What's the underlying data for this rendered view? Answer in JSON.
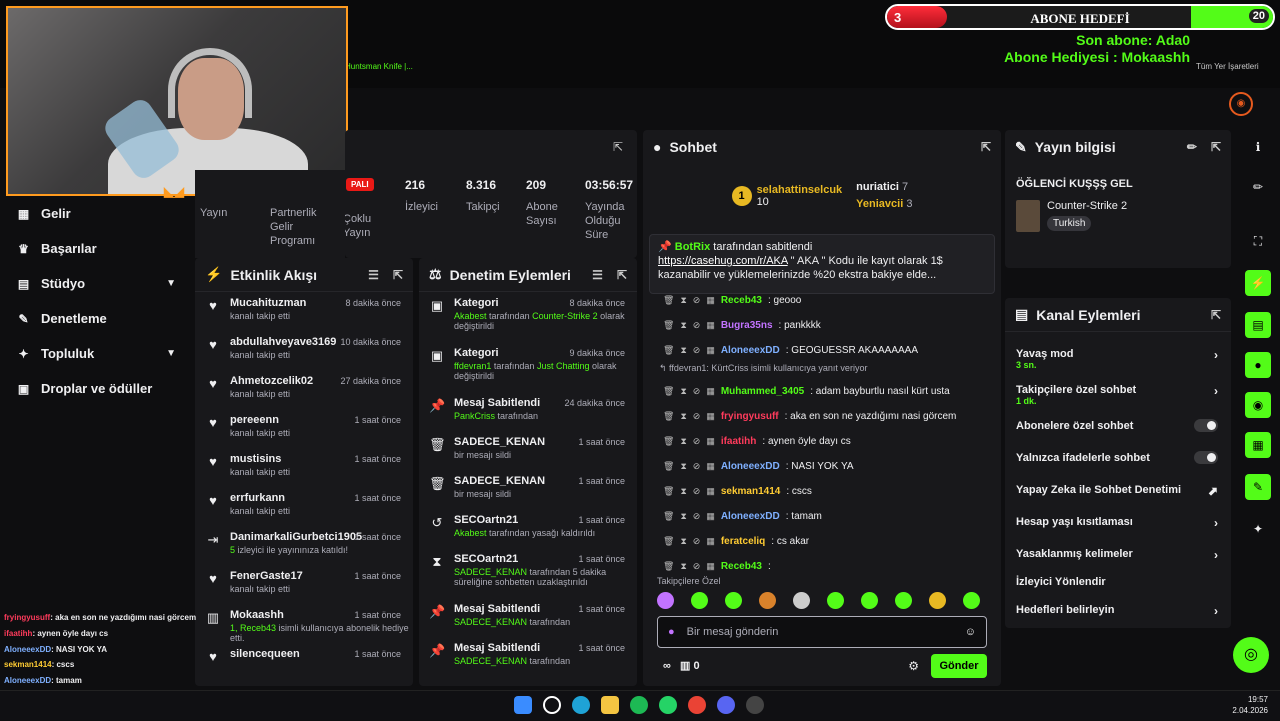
{
  "overlay_goal": {
    "current": "3",
    "title": "ABONE HEDEFİ",
    "target": "20",
    "last_sub_label": "Son abone: Ada0",
    "last_sub_name_partial": "Son abone: Ada0",
    "sub_line": "Son abone: Ada0",
    "gift_line": "Abone Hediyesi : Mokaashh"
  },
  "bookmarks": [
    "Huntsman Knife |..."
  ],
  "bookmarks_right": "Tüm Yer İşaretleri",
  "nav": {
    "items": [
      {
        "label": "Gelir",
        "icon": "income-icon"
      },
      {
        "label": "Başarılar",
        "icon": "trophy-icon"
      },
      {
        "label": "Stüdyo",
        "icon": "studio-icon"
      },
      {
        "label": "Denetleme",
        "icon": "wrench-icon"
      },
      {
        "label": "Topluluk",
        "icon": "community-icon"
      },
      {
        "label": "Droplar ve ödüller",
        "icon": "drops-icon"
      }
    ]
  },
  "stats": {
    "badge": "PALI",
    "tabs": [
      "Yayın",
      "Partnerlik Gelir Programı",
      "Çoklu Yayın"
    ],
    "items": [
      {
        "value": "216",
        "label": "İzleyici"
      },
      {
        "value": "8.316",
        "label": "Takipçi"
      },
      {
        "value": "209",
        "label": "Abone Sayısı"
      },
      {
        "value": "03:56:57",
        "label": "Yayında Olduğu Süre"
      }
    ]
  },
  "activity": {
    "title": "Etkinlik Akışı",
    "items": [
      {
        "name": "Mucahituzman",
        "sub": "kanalı takip etti",
        "time": "8 dakika önce"
      },
      {
        "name": "abdullahveyave3169",
        "sub": "kanalı takip etti",
        "time": "10 dakika önce"
      },
      {
        "name": "Ahmetozcelik02",
        "sub": "kanalı takip etti",
        "time": "27 dakika önce"
      },
      {
        "name": "pereeenn",
        "sub": "kanalı takip etti",
        "time": "1 saat önce"
      },
      {
        "name": "mustisins",
        "sub": "kanalı takip etti",
        "time": "1 saat önce"
      },
      {
        "name": "errfurkann",
        "sub": "kanalı takip etti",
        "time": "1 saat önce"
      },
      {
        "name": "DanimarkaliGurbetci1905",
        "sub_count": "5",
        "sub": "izleyici ile yayınınıza katıldı!",
        "time": "1 saat önce"
      },
      {
        "name": "FenerGaste17",
        "sub": "kanalı takip etti",
        "time": "1 saat önce"
      },
      {
        "name": "Mokaashh",
        "sub_count": "1, Receb43",
        "sub": "isimli kullanıcıya abonelik hediye etti.",
        "time": "1 saat önce"
      },
      {
        "name": "silencequeen",
        "sub": "",
        "time": "1 saat önce"
      }
    ]
  },
  "mod": {
    "title": "Denetim Eylemleri",
    "items": [
      {
        "name": "Kategori",
        "sub_user": "Akabest",
        "sub": "tarafından",
        "sub_target": "Counter-Strike 2",
        "sub2": "olarak değiştirildi",
        "time": "8 dakika önce"
      },
      {
        "name": "Kategori",
        "sub_user": "ffdevran1",
        "sub": "tarafından",
        "sub_target": "Just Chatting",
        "sub2": "olarak değiştirildi",
        "time": "9 dakika önce"
      },
      {
        "name": "Mesaj Sabitlendi",
        "sub_user": "PankCriss",
        "sub": "tarafından",
        "time": "24 dakika önce"
      },
      {
        "name": "SADECE_KENAN",
        "sub": "bir mesajı sildi",
        "time": "1 saat önce"
      },
      {
        "name": "SADECE_KENAN",
        "sub": "bir mesajı sildi",
        "time": "1 saat önce"
      },
      {
        "name": "SECOartn21",
        "sub_user": "Akabest",
        "sub": "tarafından yasağı kaldırıldı",
        "time": "1 saat önce"
      },
      {
        "name": "SECOartn21",
        "sub_user": "SADECE_KENAN",
        "sub": "tarafından 5 dakika süreliğine sohbetten uzaklaştırıldı",
        "time": "1 saat önce"
      },
      {
        "name": "Mesaj Sabitlendi",
        "sub_user": "SADECE_KENAN",
        "sub": "tarafından",
        "time": "1 saat önce"
      },
      {
        "name": "Mesaj Sabitlendi",
        "sub_user": "SADECE_KENAN",
        "sub": "tarafından",
        "time": "1 saat önce"
      }
    ]
  },
  "chat": {
    "title": "Sohbet",
    "leader": {
      "rank": "1",
      "name": "selahattinselcuk",
      "count": "10"
    },
    "leaders": [
      {
        "name": "nuriatici",
        "count": "7"
      },
      {
        "name": "Yeniavcii",
        "count": "3"
      }
    ],
    "pinned": {
      "user": "BotRix",
      "by": "tarafından sabitlendi",
      "link": "https://casehug.com/r/AKA",
      "text": " \" AKA \" Kodu ile kayıt olarak 1$ kazanabilir ve yüklemelerinizde %20 ekstra bakiye elde..."
    },
    "messages": [
      {
        "user": "Receb43",
        "text": ": geooo",
        "color": "#53fc18"
      },
      {
        "user": "Bugra35ns",
        "text": ": pankkkk",
        "color": "#c273ff"
      },
      {
        "user": "AloneeexDD",
        "text": ": GEOGUESSR AKAAAAAAA",
        "color": "#7fb0ff"
      },
      {
        "reply": "ffdevran1: KürtCriss isimli kullanıcıya yanıt veriyor"
      },
      {
        "user": "Muhammed_3405",
        "text": ": adam bayburtlu nasıl kürt usta",
        "color": "#53fc18"
      },
      {
        "user": "fryingyusuff",
        "text": ": aka en son ne yazdığımı nasi görcem",
        "color": "#ff3b5c"
      },
      {
        "user": "ifaatihh",
        "text": ": aynen öyle dayı cs",
        "color": "#ff3b5c"
      },
      {
        "user": "AloneeexDD",
        "text": ": NASI YOK YA",
        "color": "#7fb0ff"
      },
      {
        "user": "sekman1414",
        "text": ": cscs",
        "color": "#ffcc33"
      },
      {
        "user": "AloneeexDD",
        "text": ": tamam",
        "color": "#7fb0ff"
      },
      {
        "user": "feratceliq",
        "text": ": cs akar",
        "color": "#ffcc33"
      },
      {
        "user": "Receb43",
        "text": ":",
        "color": "#53fc18"
      }
    ],
    "followers_only": "Takipçilere Özel",
    "placeholder": "Bir mesaj gönderin",
    "credits": "0",
    "send": "Gönder"
  },
  "stream_info": {
    "title": "Yayın bilgisi",
    "stream_title": "ÖĞLENCİ KUŞŞŞ GEL",
    "category": "Counter-Strike 2",
    "language": "Turkish"
  },
  "channel_actions": {
    "title": "Kanal Eylemleri",
    "items": [
      {
        "label": "Yavaş mod",
        "sub": "3 sn.",
        "kind": "arrow"
      },
      {
        "label": "Takipçilere özel sohbet",
        "sub": "1 dk.",
        "kind": "arrow"
      },
      {
        "label": "Abonelere özel sohbet",
        "kind": "toggle"
      },
      {
        "label": "Yalnızca ifadelerle sohbet",
        "kind": "toggle"
      },
      {
        "label": "Yapay Zeka ile Sohbet Denetimi",
        "kind": "chart"
      },
      {
        "label": "Hesap yaşı kısıtlaması",
        "kind": "arrow"
      },
      {
        "label": "Yasaklanmış kelimeler",
        "kind": "arrow"
      },
      {
        "label": "İzleyici Yönlendir",
        "kind": "none"
      },
      {
        "label": "Hedefleri belirleyin",
        "kind": "arrow"
      }
    ]
  },
  "chat_overlay": [
    {
      "user": "fryingyusuff",
      "text": ": aka en son ne yazdığımı nasi görcem",
      "color": "#ff3b5c"
    },
    {
      "user": "ifaatihh",
      "text": ": aynen öyle dayı cs",
      "color": "#ff3b5c"
    },
    {
      "user": "AloneeexDD",
      "text": ": NASI YOK YA",
      "color": "#7fb0ff"
    },
    {
      "user": "sekman1414",
      "text": ": cscs",
      "color": "#ffcc33"
    },
    {
      "user": "AloneeexDD",
      "text": ": tamam",
      "color": "#7fb0ff"
    },
    {
      "user": "feratceliq",
      "text": ": cs akar",
      "color": "#ffcc33"
    },
    {
      "user": "Receb43",
      "text": ":",
      "color": "#53fc18"
    }
  ],
  "tray": {
    "time": "19:57",
    "date": "2.04.2026"
  },
  "colors": {
    "accent": "#53fc18",
    "bg": "#0e0e10",
    "panel": "#18181b"
  }
}
